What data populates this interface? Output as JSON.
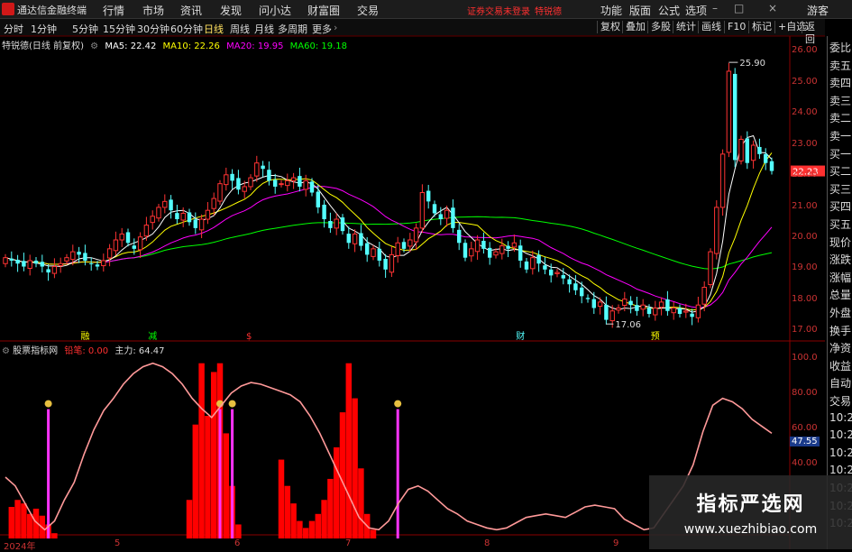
{
  "colors": {
    "up": "#ff3333",
    "down": "#54ffff",
    "ma5": "#ffffff",
    "ma10": "#ffff00",
    "ma20": "#ff00ff",
    "ma60": "#00ff00",
    "accent": "#ff3030",
    "pink": "#ff9999"
  },
  "menubar": {
    "title": "通达信金融终端",
    "items": [
      "行情",
      "市场",
      "资讯",
      "发现",
      "问小达",
      "财富圈",
      "交易"
    ],
    "notice": "证券交易未登录",
    "stock": "特锐德",
    "right_items": [
      "功能",
      "版面",
      "公式",
      "选项"
    ],
    "guest": "游客"
  },
  "toolbar": {
    "periods": [
      "分时",
      "1分钟",
      "5分钟",
      "15分钟",
      "30分钟",
      "60分钟",
      "日线",
      "周线",
      "月线",
      "多周期",
      "更多"
    ],
    "active_period": "日线",
    "tools": [
      "复权",
      "叠加",
      "多股",
      "统计",
      "画线",
      "F10",
      "标记",
      "+自选",
      "返回"
    ]
  },
  "info": {
    "stock_title": "特锐德(日线 前复权)",
    "ma5_label": "MA5: 22.42",
    "ma10_label": "MA10: 22.26",
    "ma20_label": "MA20: 19.95",
    "ma60_label": "MA60: 19.18"
  },
  "price_axis": {
    "ticks": [
      "26.00",
      "25.00",
      "24.00",
      "23.00",
      "22.00",
      "21.00",
      "20.00",
      "19.00",
      "18.00",
      "17.00"
    ],
    "max_label": "25.90",
    "min_label": "17.06",
    "current": "22.23"
  },
  "event_markers": [
    {
      "text": "融",
      "color": "#ffff00"
    },
    {
      "text": "减",
      "color": "#00ff00"
    },
    {
      "text": "$",
      "color": "#ff3030"
    },
    {
      "text": "财",
      "color": "#54ffff"
    },
    {
      "text": "预",
      "color": "#ffff00"
    }
  ],
  "indicator": {
    "name": "股票指标网",
    "label1": "铅笔: 0.00",
    "label2": "主力: 64.47",
    "ticks": [
      "100.0",
      "80.00",
      "60.00",
      "40.00"
    ],
    "current": "47.55"
  },
  "dates": [
    "2024年",
    "5",
    "6",
    "7",
    "8",
    "9"
  ],
  "side_panel": [
    "委比",
    "卖五",
    "卖四",
    "卖三",
    "卖二",
    "卖一",
    "买一",
    "买二",
    "买三",
    "买四",
    "买五",
    "现价",
    "涨跌",
    "涨幅",
    "总量",
    "外盘",
    "换手",
    "净资",
    "收益",
    "自动",
    "交易",
    "10:2",
    "10:2",
    "10:2",
    "10:2",
    "10:2",
    "10:2",
    "10:2"
  ],
  "watermark": {
    "title": "指标严选网",
    "url": "www.xuezhibiao.com"
  },
  "chart_data": {
    "type": "candlestick",
    "closes": [
      19.3,
      19.2,
      19.1,
      19.0,
      19.2,
      19.1,
      19.0,
      18.8,
      19.0,
      19.1,
      19.3,
      19.5,
      19.4,
      19.2,
      19.1,
      19.0,
      19.2,
      19.6,
      19.9,
      20.1,
      19.8,
      19.6,
      20.0,
      20.4,
      20.7,
      21.0,
      21.2,
      20.9,
      20.6,
      20.8,
      20.5,
      20.3,
      20.6,
      20.9,
      21.3,
      21.8,
      22.1,
      21.9,
      21.6,
      21.7,
      22.0,
      22.5,
      22.3,
      21.9,
      21.7,
      21.8,
      21.9,
      22.0,
      21.7,
      21.9,
      21.5,
      21.0,
      20.6,
      20.3,
      20.6,
      20.2,
      19.8,
      20.1,
      19.7,
      19.4,
      19.6,
      19.2,
      18.9,
      19.4,
      19.8,
      19.6,
      19.9,
      20.3,
      21.5,
      21.2,
      20.8,
      20.6,
      20.9,
      20.3,
      19.8,
      19.3,
      19.6,
      19.9,
      19.6,
      19.3,
      19.5,
      19.7,
      19.6,
      19.8,
      19.2,
      18.9,
      19.3,
      19.1,
      18.9,
      18.7,
      18.8,
      18.6,
      18.4,
      18.2,
      18.0,
      17.9,
      17.6,
      17.8,
      17.2,
      17.5,
      17.6,
      17.9,
      17.7,
      17.5,
      17.7,
      17.4,
      17.6,
      17.8,
      17.5,
      17.6,
      17.4,
      17.5,
      17.3,
      17.7,
      18.3,
      19.5,
      21.0,
      22.8,
      25.6,
      22.6,
      23.3,
      22.5,
      23.1,
      22.8,
      22.5,
      22.23
    ],
    "ylim": [
      16.7,
      26.3
    ],
    "last_close": 22.23,
    "indicator_line": [
      35,
      30,
      20,
      10,
      5,
      10,
      22,
      32,
      48,
      62,
      73,
      80,
      88,
      94,
      98,
      100,
      98,
      94,
      88,
      80,
      74,
      69,
      76,
      83,
      87,
      89,
      88,
      86,
      84,
      82,
      78,
      70,
      60,
      48,
      36,
      24,
      12,
      6,
      5,
      10,
      20,
      28,
      30,
      27,
      22,
      17,
      14,
      10,
      8,
      6,
      5,
      6,
      9,
      12,
      13,
      14,
      13,
      12,
      15,
      18,
      19,
      18,
      17,
      11,
      8,
      5,
      6,
      14,
      22,
      30,
      42,
      61,
      76,
      80,
      78,
      74,
      68,
      64,
      60
    ],
    "indicator_ylim": [
      0,
      105
    ],
    "bars": [
      {
        "i": 1,
        "h": 18
      },
      {
        "i": 2,
        "h": 22
      },
      {
        "i": 3,
        "h": 20
      },
      {
        "i": 4,
        "h": 14
      },
      {
        "i": 5,
        "h": 17
      },
      {
        "i": 6,
        "h": 13
      },
      {
        "i": 7,
        "h": 8
      },
      {
        "i": 8,
        "h": 3
      },
      {
        "i": 30,
        "h": 22
      },
      {
        "i": 31,
        "h": 65
      },
      {
        "i": 32,
        "h": 100
      },
      {
        "i": 33,
        "h": 70
      },
      {
        "i": 34,
        "h": 95
      },
      {
        "i": 35,
        "h": 100
      },
      {
        "i": 36,
        "h": 60
      },
      {
        "i": 37,
        "h": 30
      },
      {
        "i": 38,
        "h": 8
      },
      {
        "i": 45,
        "h": 45
      },
      {
        "i": 46,
        "h": 30
      },
      {
        "i": 47,
        "h": 20
      },
      {
        "i": 48,
        "h": 10
      },
      {
        "i": 49,
        "h": 6
      },
      {
        "i": 50,
        "h": 10
      },
      {
        "i": 51,
        "h": 14
      },
      {
        "i": 52,
        "h": 22
      },
      {
        "i": 53,
        "h": 34
      },
      {
        "i": 54,
        "h": 52
      },
      {
        "i": 55,
        "h": 72
      },
      {
        "i": 56,
        "h": 100
      },
      {
        "i": 57,
        "h": 80
      },
      {
        "i": 58,
        "h": 40
      },
      {
        "i": 59,
        "h": 14
      },
      {
        "i": 60,
        "h": 5
      }
    ],
    "signals": [
      7,
      35,
      37,
      64
    ]
  }
}
